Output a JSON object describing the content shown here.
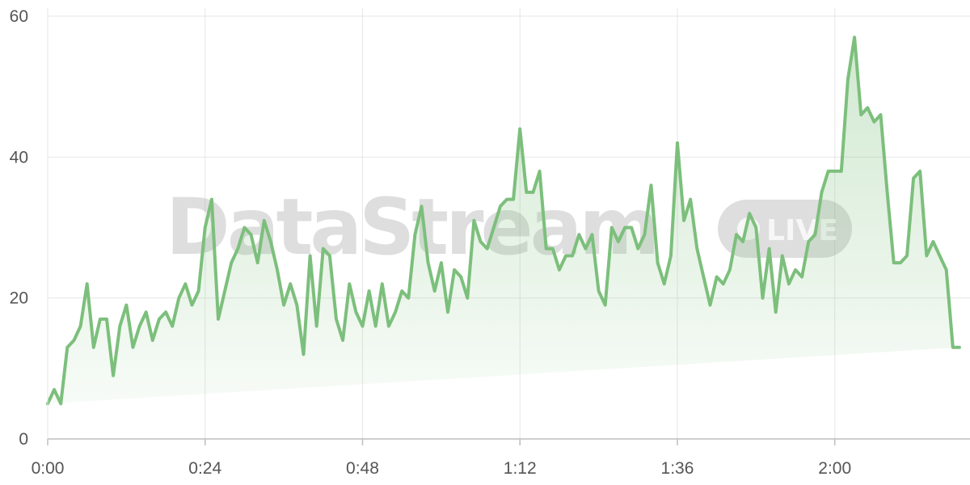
{
  "watermark": {
    "brand": "DataStream",
    "badge": "LIVE"
  },
  "chart_data": {
    "type": "area",
    "title": "",
    "xlabel": "",
    "ylabel": "",
    "x_unit": "minutes",
    "x_range": [
      0,
      140
    ],
    "ylim": [
      0,
      60
    ],
    "y_ticks": [
      0,
      20,
      40,
      60
    ],
    "x_ticks": [
      {
        "value": 0,
        "label": "0:00"
      },
      {
        "value": 24,
        "label": "0:24"
      },
      {
        "value": 48,
        "label": "0:48"
      },
      {
        "value": 72,
        "label": "1:12"
      },
      {
        "value": 96,
        "label": "1:36"
      },
      {
        "value": 120,
        "label": "2:00"
      }
    ],
    "grid": true,
    "line_color": "#7cbf7c",
    "fill_color": "#7cbf7c",
    "x": [
      0,
      1,
      2,
      3,
      4,
      5,
      6,
      7,
      8,
      9,
      10,
      11,
      12,
      13,
      14,
      15,
      16,
      17,
      18,
      19,
      20,
      21,
      22,
      23,
      24,
      25,
      26,
      27,
      28,
      29,
      30,
      31,
      32,
      33,
      34,
      35,
      36,
      37,
      38,
      39,
      40,
      41,
      42,
      43,
      44,
      45,
      46,
      47,
      48,
      49,
      50,
      51,
      52,
      53,
      54,
      55,
      56,
      57,
      58,
      59,
      60,
      61,
      62,
      63,
      64,
      65,
      66,
      67,
      68,
      69,
      70,
      71,
      72,
      73,
      74,
      75,
      76,
      77,
      78,
      79,
      80,
      81,
      82,
      83,
      84,
      85,
      86,
      87,
      88,
      89,
      90,
      91,
      92,
      93,
      94,
      95,
      96,
      97,
      98,
      99,
      100,
      101,
      102,
      103,
      104,
      105,
      106,
      107,
      108,
      109,
      110,
      111,
      112,
      113,
      114,
      115,
      116,
      117,
      118,
      119,
      120,
      121,
      122,
      123,
      124,
      125,
      126,
      127,
      128,
      129,
      130,
      131,
      132,
      133,
      134,
      135,
      136,
      137,
      138,
      139,
      140
    ],
    "values": [
      5,
      7,
      5,
      13,
      14,
      16,
      22,
      13,
      17,
      17,
      9,
      16,
      19,
      13,
      16,
      18,
      14,
      17,
      18,
      16,
      20,
      22,
      19,
      21,
      30,
      34,
      17,
      21,
      25,
      27,
      30,
      29,
      25,
      31,
      28,
      24,
      19,
      22,
      19,
      12,
      26,
      16,
      27,
      26,
      17,
      14,
      22,
      18,
      16,
      21,
      16,
      22,
      16,
      18,
      21,
      20,
      29,
      33,
      25,
      21,
      25,
      18,
      24,
      23,
      20,
      31,
      28,
      27,
      30,
      33,
      34,
      34,
      44,
      35,
      35,
      38,
      27,
      27,
      24,
      26,
      26,
      29,
      27,
      29,
      21,
      19,
      30,
      28,
      30,
      30,
      27,
      29,
      36,
      25,
      22,
      26,
      42,
      31,
      34,
      27,
      23,
      19,
      23,
      22,
      24,
      29,
      28,
      32,
      30,
      20,
      27,
      18,
      26,
      22,
      24,
      23,
      28,
      29,
      35,
      38,
      38,
      38,
      51,
      57,
      46,
      47,
      45,
      46,
      35,
      25,
      25,
      26,
      37,
      38,
      26,
      28,
      26,
      24,
      13,
      13
    ]
  }
}
